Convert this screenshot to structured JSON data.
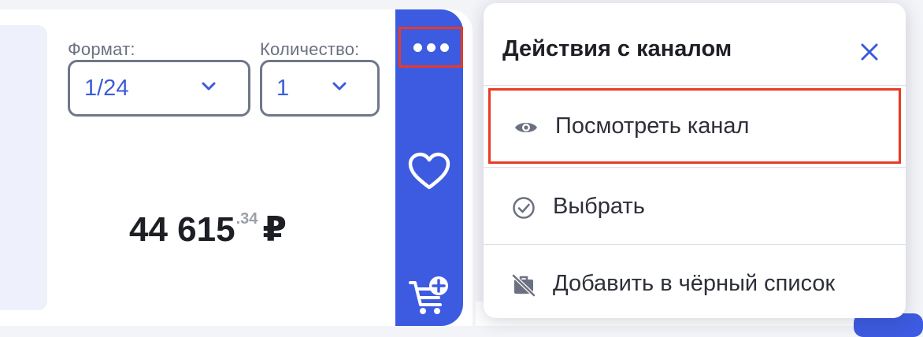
{
  "card": {
    "format_label": "Формат:",
    "format_value": "1/24",
    "quantity_label": "Количество:",
    "quantity_value": "1",
    "price_main": "44 615",
    "price_fraction": ".34",
    "price_currency": "₽"
  },
  "actions": {
    "more_icon": "more-dots-icon",
    "favorite_icon": "heart-icon",
    "cart_icon": "cart-add-icon"
  },
  "menu": {
    "title": "Действия с каналом",
    "items": [
      {
        "label": "Посмотреть канал",
        "icon": "eye-icon"
      },
      {
        "label": "Выбрать",
        "icon": "check-circle-icon"
      },
      {
        "label": "Добавить в чёрный список",
        "icon": "blocked-briefcase-icon"
      }
    ]
  },
  "colors": {
    "accent": "#3d5be0",
    "highlight": "#ea3a24",
    "select_border": "#6f7788"
  }
}
